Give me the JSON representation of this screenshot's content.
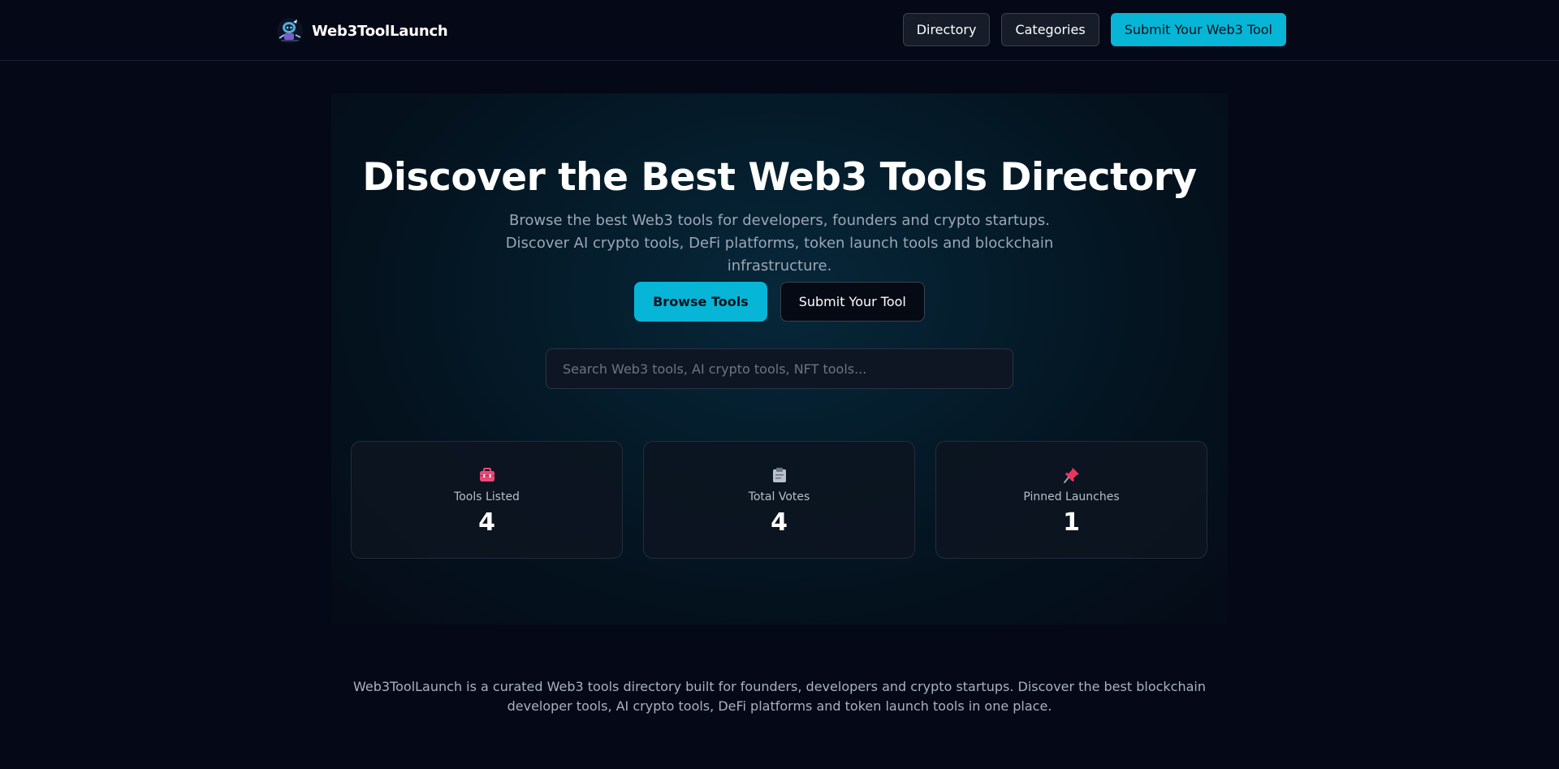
{
  "header": {
    "brand_name": "Web3ToolLaunch",
    "logo_icon": "robot-astronaut-logo",
    "nav": [
      {
        "label": "Directory"
      },
      {
        "label": "Categories"
      },
      {
        "label": "Submit Your Web3 Tool"
      }
    ]
  },
  "hero": {
    "title": "Discover the Best Web3 Tools Directory",
    "subtitle": "Browse the best Web3 tools for developers, founders and crypto startups. Discover AI crypto tools, DeFi platforms, token launch tools and blockchain infrastructure.",
    "browse_label": "Browse Tools",
    "submit_label": "Submit Your Tool",
    "search_placeholder": "Search Web3 tools, AI crypto tools, NFT tools..."
  },
  "stats": [
    {
      "icon": "toolbox-icon",
      "label": "Tools Listed",
      "value": "4"
    },
    {
      "icon": "clipboard-icon",
      "label": "Total Votes",
      "value": "4"
    },
    {
      "icon": "pushpin-icon",
      "label": "Pinned Launches",
      "value": "1"
    }
  ],
  "about": {
    "text": "Web3ToolLaunch is a curated Web3 tools directory built for founders, developers and crypto startups. Discover the best blockchain developer tools, AI crypto tools, DeFi platforms and token launch tools in one place."
  },
  "colors": {
    "background": "#050816",
    "accent": "#07b5d6",
    "muted_text": "#9ca6b6"
  }
}
